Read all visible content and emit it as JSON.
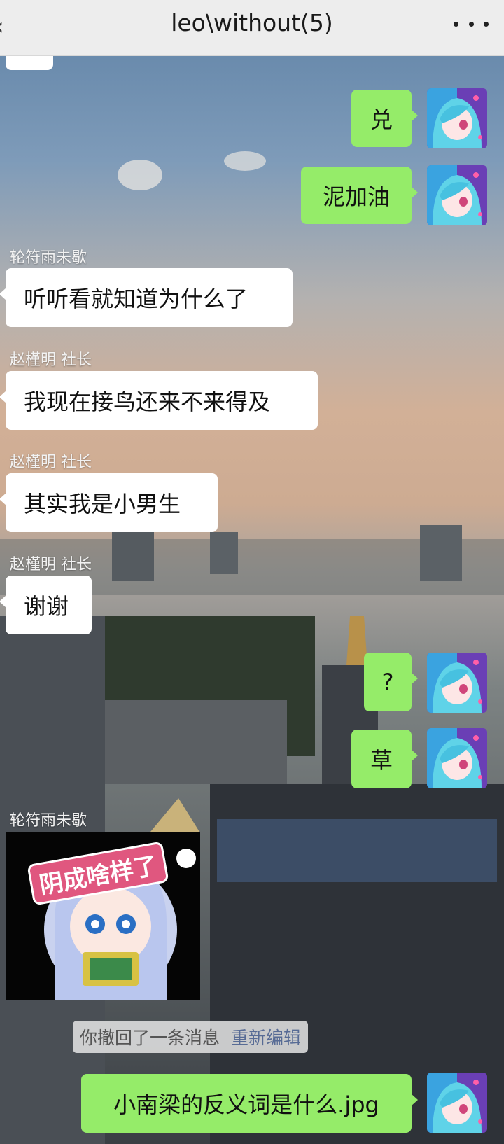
{
  "header": {
    "title": "leo\\without(5)",
    "back_glyph": "‹",
    "more_icon": "more-dots-icon"
  },
  "colors": {
    "header_bg": "#ededed",
    "outgoing_bubble": "#95ec69",
    "incoming_bubble": "#ffffff",
    "link": "#576b95"
  },
  "messages": [
    {
      "direction": "out",
      "text": "兑"
    },
    {
      "direction": "out",
      "text": "泥加油"
    },
    {
      "direction": "in",
      "sender": "轮符雨未歇",
      "text": "听听看就知道为什么了"
    },
    {
      "direction": "in",
      "sender": "赵槿明 社长",
      "text": "我现在接鸟还来不来得及"
    },
    {
      "direction": "in",
      "sender": "赵槿明 社长",
      "text": "其实我是小男生"
    },
    {
      "direction": "in",
      "sender": "赵槿明 社长",
      "text": "谢谢"
    },
    {
      "direction": "out",
      "text": "?"
    },
    {
      "direction": "out",
      "text": "草"
    },
    {
      "direction": "in",
      "sender": "轮符雨未歇",
      "type": "sticker",
      "sticker_text": "阴成啥样了"
    },
    {
      "type": "system",
      "text": "你撤回了一条消息",
      "action": "重新编辑"
    },
    {
      "direction": "out",
      "text": "小南梁的反义词是什么.jpg"
    }
  ]
}
